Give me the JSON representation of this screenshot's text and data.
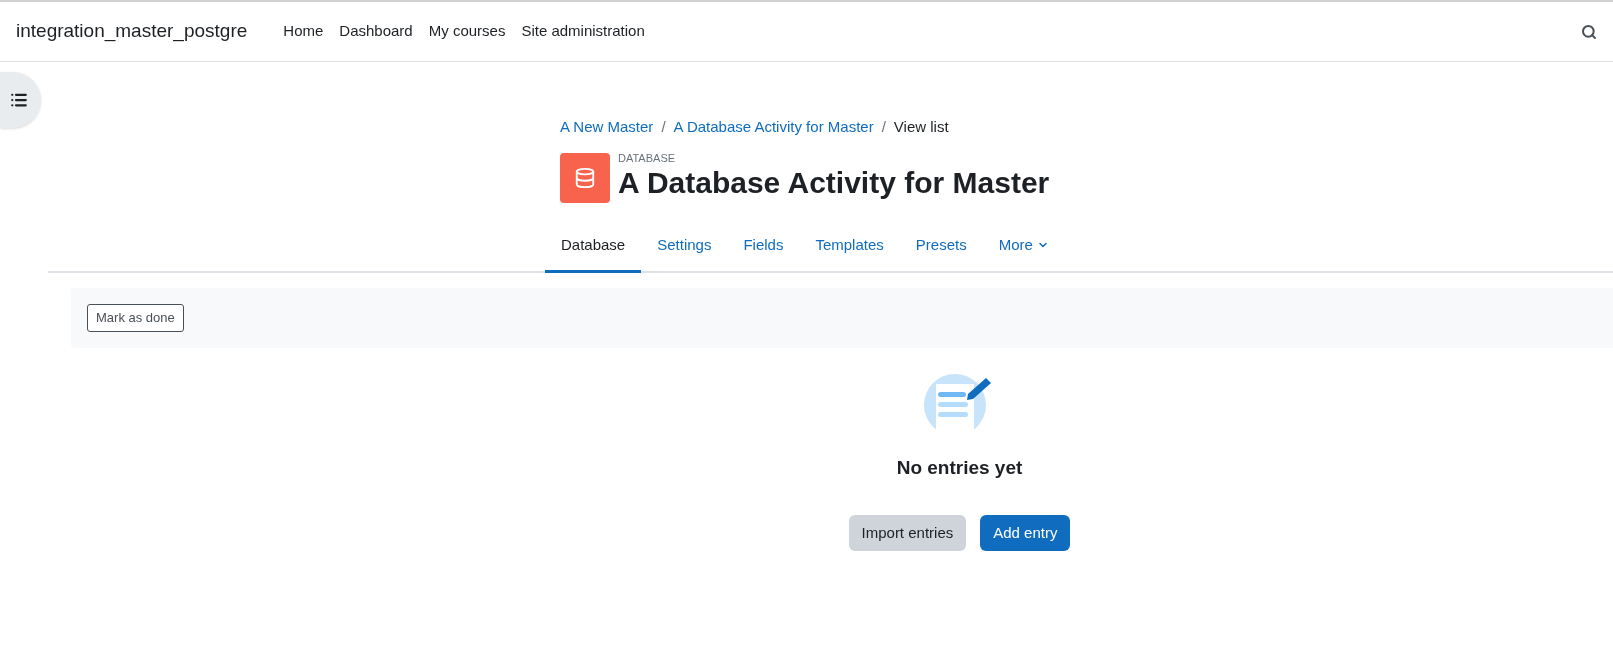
{
  "navbar": {
    "site_name": "integration_master_postgre",
    "links": [
      {
        "label": "Home"
      },
      {
        "label": "Dashboard"
      },
      {
        "label": "My courses"
      },
      {
        "label": "Site administration"
      }
    ]
  },
  "breadcrumb": [
    {
      "label": "A New Master",
      "link": true
    },
    {
      "label": "A Database Activity for Master",
      "link": true
    },
    {
      "label": "View list",
      "link": false
    }
  ],
  "breadcrumb_separator": "/",
  "activity": {
    "type_label": "DATABASE",
    "title": "A Database Activity for Master"
  },
  "tabs": [
    {
      "label": "Database",
      "selected": true
    },
    {
      "label": "Settings",
      "selected": false
    },
    {
      "label": "Fields",
      "selected": false
    },
    {
      "label": "Templates",
      "selected": false
    },
    {
      "label": "Presets",
      "selected": false
    },
    {
      "label": "More",
      "selected": false,
      "dropdown": true
    }
  ],
  "completion": {
    "button": "Mark as done"
  },
  "empty_state": {
    "message": "No entries yet",
    "buttons": [
      {
        "label": "Import entries",
        "kind": "secondary"
      },
      {
        "label": "Add entry",
        "kind": "primary"
      }
    ]
  }
}
